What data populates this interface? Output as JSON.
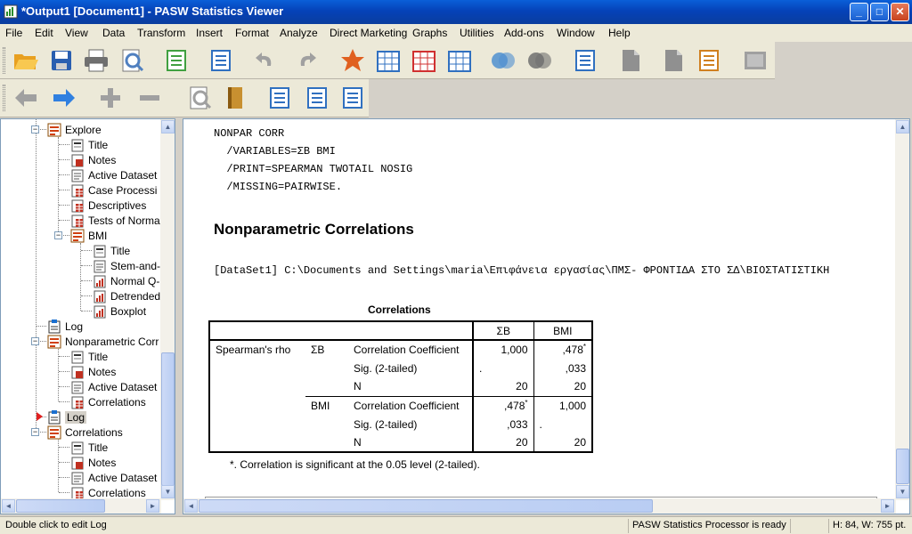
{
  "window": {
    "title": "*Output1 [Document1] - PASW Statistics Viewer",
    "buttons": {
      "minimize": "_",
      "maximize": "□",
      "close": "✕"
    }
  },
  "menu": [
    "File",
    "Edit",
    "View",
    "Data",
    "Transform",
    "Insert",
    "Format",
    "Analyze",
    "Direct Marketing",
    "Graphs",
    "Utilities",
    "Add-ons",
    "Window",
    "Help"
  ],
  "toolbar1": [
    {
      "name": "open-icon",
      "color": "#e8a020"
    },
    {
      "name": "save-icon",
      "color": "#2a5fb0"
    },
    {
      "name": "print-icon",
      "color": "#707070"
    },
    {
      "name": "print-preview-icon",
      "color": "#5080c0"
    },
    {
      "name": "export-icon",
      "color": "#40a040"
    },
    {
      "name": "recall-dialog-icon",
      "color": "#3070c0"
    },
    {
      "name": "undo-icon",
      "color": "#a0a0a0"
    },
    {
      "name": "redo-icon",
      "color": "#a0a0a0"
    },
    {
      "name": "goto-data-icon",
      "color": "#e06020"
    },
    {
      "name": "goto-case-icon",
      "color": "#3070c0"
    },
    {
      "name": "goto-variable-icon",
      "color": "#d03030"
    },
    {
      "name": "variables-icon",
      "color": "#3070c0"
    },
    {
      "name": "use-sets-icon",
      "color": "#5090d0"
    },
    {
      "name": "show-all-variables-icon",
      "color": "#707070"
    },
    {
      "name": "spell-check-icon",
      "color": "#3070c0"
    },
    {
      "name": "designate-window-icon",
      "color": "#909090"
    },
    {
      "name": "insert-output-icon",
      "color": "#909090"
    },
    {
      "name": "scripting-icon",
      "color": "#d08020"
    },
    {
      "name": "disabled-icon",
      "color": "#a0a0a0"
    }
  ],
  "toolbar2": [
    {
      "name": "promote-icon",
      "color": "#a0a0a0"
    },
    {
      "name": "demote-icon",
      "color": "#3080e0"
    },
    {
      "name": "expand-icon",
      "color": "#a0a0a0"
    },
    {
      "name": "collapse-icon",
      "color": "#a0a0a0"
    },
    {
      "name": "show-icon",
      "color": "#a0a0a0"
    },
    {
      "name": "hide-icon",
      "color": "#c89030"
    },
    {
      "name": "insert-heading-icon",
      "color": "#3070c0"
    },
    {
      "name": "insert-title-icon",
      "color": "#3070c0"
    },
    {
      "name": "insert-text-icon",
      "color": "#3070c0"
    }
  ],
  "outline": {
    "items": [
      {
        "label": "Explore",
        "type": "group",
        "level": 1,
        "expanded": true
      },
      {
        "label": "Title",
        "type": "title",
        "level": 2
      },
      {
        "label": "Notes",
        "type": "notes",
        "level": 2
      },
      {
        "label": "Active Dataset",
        "type": "item",
        "level": 2
      },
      {
        "label": "Case Processi",
        "type": "table",
        "level": 2
      },
      {
        "label": "Descriptives",
        "type": "table",
        "level": 2
      },
      {
        "label": "Tests of Norma",
        "type": "table",
        "level": 2
      },
      {
        "label": "BMI",
        "type": "group",
        "level": 2,
        "expanded": true
      },
      {
        "label": "Title",
        "type": "title",
        "level": 3
      },
      {
        "label": "Stem-and-",
        "type": "item",
        "level": 3
      },
      {
        "label": "Normal Q-",
        "type": "chart",
        "level": 3
      },
      {
        "label": "Detrended",
        "type": "chart",
        "level": 3
      },
      {
        "label": "Boxplot",
        "type": "chart",
        "level": 3
      },
      {
        "label": "Log",
        "type": "log",
        "level": 1
      },
      {
        "label": "Nonparametric Corr",
        "type": "group",
        "level": 1,
        "expanded": true
      },
      {
        "label": "Title",
        "type": "title",
        "level": 2
      },
      {
        "label": "Notes",
        "type": "notes",
        "level": 2
      },
      {
        "label": "Active Dataset",
        "type": "item",
        "level": 2
      },
      {
        "label": "Correlations",
        "type": "table",
        "level": 2
      },
      {
        "label": "Log",
        "type": "log",
        "level": 1,
        "selected": true
      },
      {
        "label": "Correlations",
        "type": "group",
        "level": 1,
        "expanded": true
      },
      {
        "label": "Title",
        "type": "title",
        "level": 2
      },
      {
        "label": "Notes",
        "type": "notes",
        "level": 2
      },
      {
        "label": "Active Dataset",
        "type": "item",
        "level": 2
      },
      {
        "label": "Correlations",
        "type": "table",
        "level": 2
      }
    ]
  },
  "syntax": [
    "NONPAR CORR",
    "  /VARIABLES=ΣΒ BMI",
    "  /PRINT=SPEARMAN TWOTAIL NOSIG",
    "  /MISSING=PAIRWISE."
  ],
  "heading": "Nonparametric Correlations",
  "dataset_line": "[DataSet1] C:\\Documents and Settings\\maria\\Επιφάνεια εργασίας\\ΠΜΣ- ΦΡΟΝΤΙΔΑ ΣΤΟ ΣΔ\\ΒΙΟΣΤΑΤΙΣΤΙΚΗ",
  "table": {
    "title": "Correlations",
    "col_headers": [
      "ΣΒ",
      "BMI"
    ],
    "stub": "Spearman's rho",
    "groups": [
      {
        "var": "ΣΒ",
        "rows": [
          {
            "stat": "Correlation Coefficient",
            "c1": "1,000",
            "c2": ",478",
            "c2_sup": "*"
          },
          {
            "stat": "Sig. (2-tailed)",
            "c1": ".",
            "c2": ",033"
          },
          {
            "stat": "N",
            "c1": "20",
            "c2": "20"
          }
        ]
      },
      {
        "var": "BMI",
        "rows": [
          {
            "stat": "Correlation Coefficient",
            "c1": ",478",
            "c1_sup": "*",
            "c2": "1,000"
          },
          {
            "stat": "Sig. (2-tailed)",
            "c1": ",033",
            "c2": "."
          },
          {
            "stat": "N",
            "c1": "20",
            "c2": "20"
          }
        ]
      }
    ],
    "footnote": "*. Correlation is significant at the 0.05 level (2-tailed)."
  },
  "status": {
    "hint": "Double click to edit Log",
    "processor": "PASW Statistics Processor is ready",
    "size": "H: 84, W: 755 pt."
  },
  "colors": {
    "titlebar": "#0542b8",
    "selection_arrow": "#e02020"
  }
}
